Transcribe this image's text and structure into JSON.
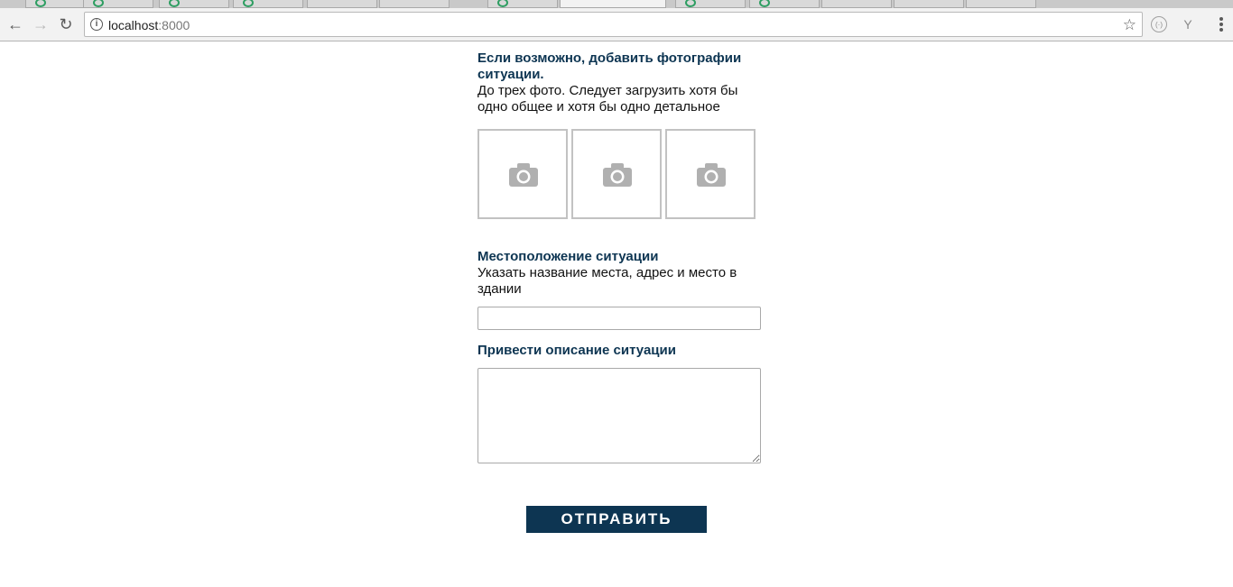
{
  "browser": {
    "url_host": "localhost",
    "url_port": ":8000",
    "info_glyph": "i",
    "star_glyph": "☆",
    "back_glyph": "←",
    "forward_glyph": "→",
    "reload_glyph": "↻",
    "ext1_glyph": "(·)",
    "ext2_glyph": "Y"
  },
  "form": {
    "photos_title": "Если возможно, добавить фотографии ситуации.",
    "photos_hint": "До трех фото. Следует загрузить хотя бы одно общее и хотя бы одно детальное",
    "photo_slot_count": 3,
    "location_title": "Местоположение ситуации",
    "location_hint": "Указать название места, адрес и место в здании",
    "location_value": "",
    "description_title": "Привести описание ситуации",
    "description_value": "",
    "submit_label": "ОТПРАВИТЬ"
  },
  "colors": {
    "accent": "#0d3552",
    "photo_border": "#c2c2c2",
    "camera_icon": "#b0b0b0"
  }
}
